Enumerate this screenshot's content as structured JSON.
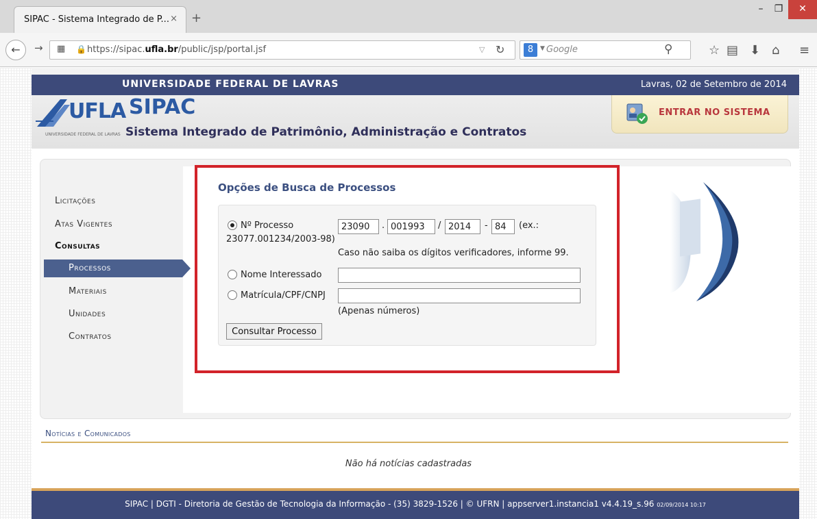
{
  "browser": {
    "tab_title": "SIPAC - Sistema Integrado de P...",
    "tab_close": "×",
    "new_tab": "+",
    "url_prefix": "https://sipac.",
    "url_domain": "ufla.br",
    "url_path": "/public/jsp/portal.jsf",
    "search_placeholder": "Google",
    "search_engine_label": "8",
    "icons": [
      "back-arrow-icon",
      "forward-arrow-icon",
      "lock-icon",
      "reload-icon",
      "search-icon",
      "star-icon",
      "reading-list-icon",
      "download-icon",
      "home-icon",
      "menu-icon"
    ]
  },
  "header": {
    "university": "UNIVERSIDADE FEDERAL DE LAVRAS",
    "date": "Lavras, 02 de Setembro de 2014",
    "logo_text": "UFLA",
    "logo_subtext": "UNIVERSIDADE FEDERAL DE LAVRAS",
    "title": "SIPAC",
    "subtitle": "Sistema Integrado de Patrimônio, Administração e Contratos",
    "login_label": "ENTRAR NO SISTEMA"
  },
  "sidebar": {
    "items": [
      {
        "label": "Licitações"
      },
      {
        "label": "Atas Vigentes"
      },
      {
        "label": "Consultas"
      },
      {
        "label": "Processos"
      },
      {
        "label": "Materiais"
      },
      {
        "label": "Unidades"
      },
      {
        "label": "Contratos"
      }
    ],
    "active": "Processos"
  },
  "search": {
    "title": "Opções de Busca de Processos",
    "option_processo": "Nº Processo",
    "processo_parts": [
      "23090",
      "001993",
      "2014",
      "84"
    ],
    "sep_dot": ".",
    "sep_slash": "/",
    "sep_dash": "-",
    "example_start": "(ex.:",
    "example_end": "23077.001234/2003-98)",
    "hint_digits": "Caso não saiba os dígitos verificadores, informe 99.",
    "option_nome": "Nome Interessado",
    "nome_value": "",
    "option_matricula": "Matrícula/CPF/CNPJ",
    "matricula_value": "",
    "hint_numbers": "(Apenas números)",
    "submit_label": "Consultar Processo",
    "selected_option": "Nº Processo"
  },
  "news": {
    "title": "Notícias e Comunicados",
    "empty_message": "Não há notícias cadastradas"
  },
  "footer": {
    "text": "SIPAC | DGTI - Diretoria de Gestão de Tecnologia da Informação - (35) 3829-1526 | © UFRN | appserver1.instancia1 v4.4.19_s.96",
    "timestamp": "02/09/2014 10:17"
  },
  "colors": {
    "header_bar": "#3d4a7a",
    "accent_blue": "#2c5aa3",
    "menu_active": "#4b608e",
    "highlight_frame": "#d2232a",
    "login_text": "#b8373d",
    "footer_accent": "#d7a35a"
  }
}
